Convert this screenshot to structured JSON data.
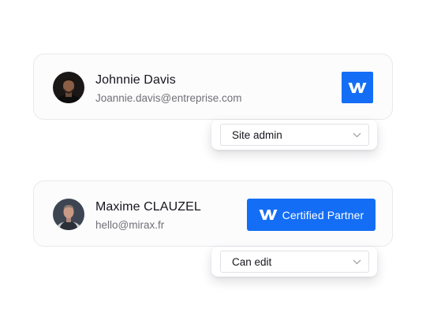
{
  "members": [
    {
      "name": "Johnnie Davis",
      "email": "Joannie.davis@entreprise.com",
      "badge_icon": "webflow-logo-icon",
      "role": "Site admin"
    },
    {
      "name": "Maxime CLAUZEL",
      "email": "hello@mirax.fr",
      "badge_icon": "webflow-logo-icon",
      "badge_label": "Certified Partner",
      "role": "Can edit"
    }
  ],
  "colors": {
    "brand_blue": "#146ef5",
    "text_primary": "#16161d",
    "text_secondary": "#707078"
  },
  "icons": {
    "dropdown": "chevron-down-icon"
  }
}
